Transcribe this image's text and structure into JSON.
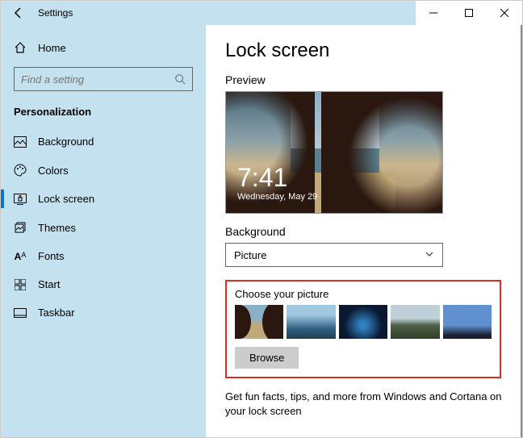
{
  "window": {
    "title": "Settings"
  },
  "sidebar": {
    "home": "Home",
    "search_placeholder": "Find a setting",
    "section": "Personalization",
    "items": [
      {
        "label": "Background"
      },
      {
        "label": "Colors"
      },
      {
        "label": "Lock screen"
      },
      {
        "label": "Themes"
      },
      {
        "label": "Fonts"
      },
      {
        "label": "Start"
      },
      {
        "label": "Taskbar"
      }
    ]
  },
  "main": {
    "title": "Lock screen",
    "preview_label": "Preview",
    "clock_time": "7:41",
    "clock_date": "Wednesday, May 29",
    "background_label": "Background",
    "background_value": "Picture",
    "choose_label": "Choose your picture",
    "browse_label": "Browse",
    "footer": "Get fun facts, tips, and more from Windows and Cortana on your lock screen"
  }
}
